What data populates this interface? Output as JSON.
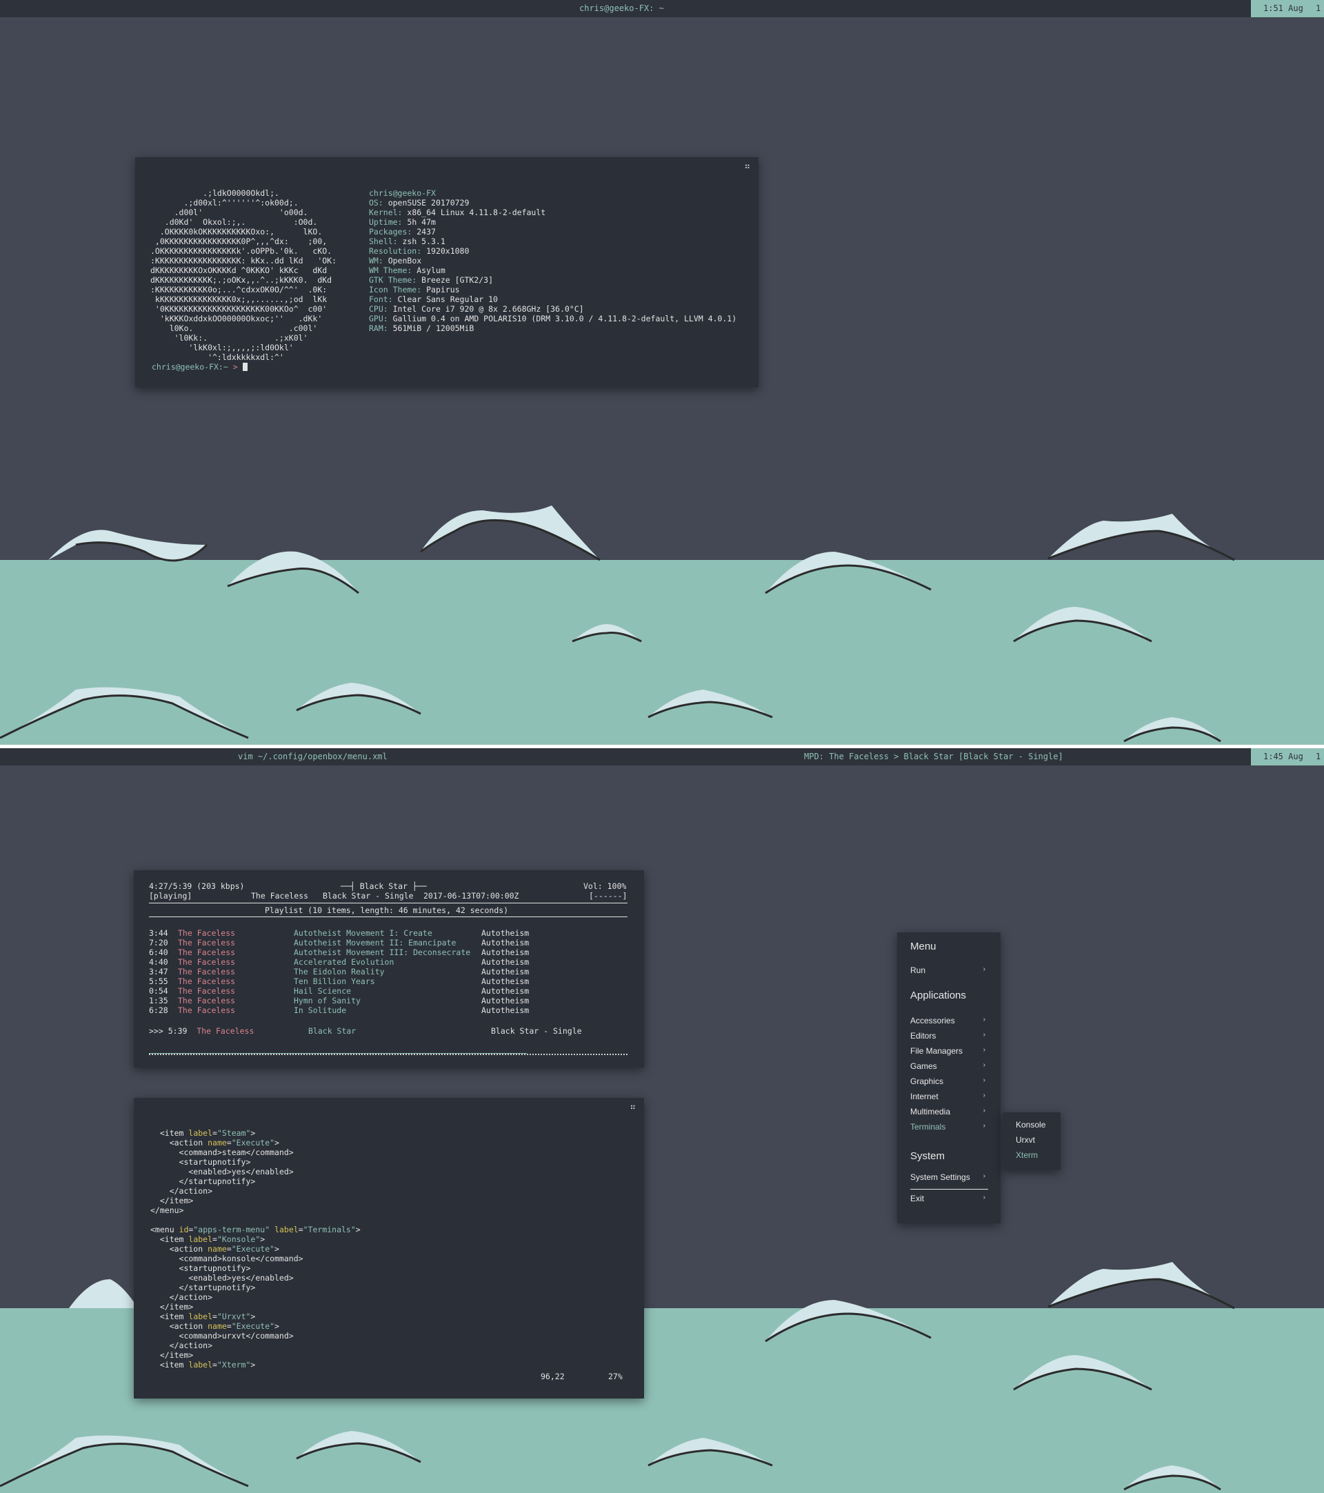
{
  "colors": {
    "bg": "#434854",
    "bar": "#2e323b",
    "accent": "#8fc0b6",
    "terminal": "#2b2f38",
    "sea": "#8fc0b6",
    "wave": "#d3e6ea",
    "red": "#d9848c"
  },
  "screen1": {
    "bar_title": "chris@geeko-FX: ~",
    "clock": "1:51 Aug",
    "workspace": "1",
    "terminal": {
      "ascii": [
        "           .;ldkO0000Okdl;.",
        "       .;d00xl:^''''''^:ok00d;.",
        "     .d00l'                'o00d.",
        "   .d0Kd'  Okxol:;,.          :O0d.",
        "  .OKKKK0kOKKKKKKKKKKOxo:,      lKO.",
        " ,0KKKKKKKKKKKKKKKK0P^,,,^dx:    ;00,",
        ".OKKKKKKKKKKKKKKKKk'.oOPPb.'0k.   cKO.",
        ":KKKKKKKKKKKKKKKKKK: kKx..dd lKd   'OK:",
        "dKKKKKKKKKOxOKKKKd ^0KKKO' kKKc   dKd",
        "dKKKKKKKKKKKK;.;oOKx,,.^..;kKKK0.  dKd",
        ":KKKKKKKKKKK0o;...^cdxxOK0O/^^'  .0K:",
        " kKKKKKKKKKKKKKKK0x;,,......,;od  lKk",
        " '0KKKKKKKKKKKKKKKKKKKKK00KKOo^  c00'",
        "  'kKKKOxddxkOO00000Okxoc;''   .dKk'",
        "    l0Ko.                    .c00l'",
        "     'l0Kk:.              .;xK0l'",
        "        'lkK0xl:;,,,,;:ld0Okl'",
        "            '^:ldxkkkkxdl:^'"
      ],
      "info": [
        {
          "k": "chris@geeko-FX",
          "v": ""
        },
        {
          "k": "OS:",
          "v": " openSUSE 20170729"
        },
        {
          "k": "Kernel:",
          "v": " x86_64 Linux 4.11.8-2-default"
        },
        {
          "k": "Uptime:",
          "v": " 5h 47m"
        },
        {
          "k": "Packages:",
          "v": " 2437"
        },
        {
          "k": "Shell:",
          "v": " zsh 5.3.1"
        },
        {
          "k": "Resolution:",
          "v": " 1920x1080"
        },
        {
          "k": "WM:",
          "v": " OpenBox"
        },
        {
          "k": "WM Theme:",
          "v": " Asylum"
        },
        {
          "k": "GTK Theme:",
          "v": " Breeze [GTK2/3]"
        },
        {
          "k": "Icon Theme:",
          "v": " Papirus"
        },
        {
          "k": "Font:",
          "v": " Clear Sans Regular 10"
        },
        {
          "k": "CPU:",
          "v": " Intel Core i7 920 @ 8x 2.668GHz [36.0°C]"
        },
        {
          "k": "GPU:",
          "v": " Gallium 0.4 on AMD POLARIS10 (DRM 3.10.0 / 4.11.8-2-default, LLVM 4.0.1)"
        },
        {
          "k": "RAM:",
          "v": " 561MiB / 12005MiB"
        }
      ],
      "prompt_user": "chris@geeko-FX:~",
      "prompt_symbol": " > "
    }
  },
  "screen2": {
    "bar_left": "vim ~/.config/openbox/menu.xml",
    "bar_mid": "MPD: The Faceless > Black Star [Black Star - Single]",
    "clock": "1:45 Aug",
    "workspace": "1",
    "ncmpcpp": {
      "time": "4:27/5:39 (203 kbps)",
      "song_title": "Black Star",
      "volume": "Vol: 100%",
      "state": "[playing]",
      "now_artist": "The Faceless",
      "now_album": "Black Star - Single",
      "now_date": "2017-06-13T07:00:00Z",
      "mode_flags": "[------]",
      "playlist_header": "Playlist (10 items, length: 46 minutes, 42 seconds)",
      "playlist": [
        {
          "time": "3:44",
          "artist": "The Faceless",
          "title": "Autotheist Movement I: Create",
          "album": "Autotheism"
        },
        {
          "time": "7:20",
          "artist": "The Faceless",
          "title": "Autotheist Movement II: Emancipate",
          "album": "Autotheism"
        },
        {
          "time": "6:40",
          "artist": "The Faceless",
          "title": "Autotheist Movement III: Deconsecrate",
          "album": "Autotheism"
        },
        {
          "time": "4:40",
          "artist": "The Faceless",
          "title": "Accelerated Evolution",
          "album": "Autotheism"
        },
        {
          "time": "3:47",
          "artist": "The Faceless",
          "title": "The Eidolon Reality",
          "album": "Autotheism"
        },
        {
          "time": "5:55",
          "artist": "The Faceless",
          "title": "Ten Billion Years",
          "album": "Autotheism"
        },
        {
          "time": "0:54",
          "artist": "The Faceless",
          "title": "Hail Science",
          "album": "Autotheism"
        },
        {
          "time": "1:35",
          "artist": "The Faceless",
          "title": "Hymn of Sanity",
          "album": "Autotheism"
        },
        {
          "time": "6:28",
          "artist": "The Faceless",
          "title": "In Solitude",
          "album": "Autotheism"
        }
      ],
      "current": {
        "marker": ">>>",
        "time": "5:39",
        "artist": "The Faceless",
        "title": "Black Star",
        "album": "Black Star - Single"
      },
      "progress": 0.79
    },
    "vim": {
      "lines": [
        "  <item label=\"Steam\">",
        "    <action name=\"Execute\">",
        "      <command>steam</command>",
        "      <startupnotify>",
        "        <enabled>yes</enabled>",
        "      </startupnotify>",
        "    </action>",
        "  </item>",
        "</menu>",
        "",
        "<menu id=\"apps-term-menu\" label=\"Terminals\">",
        "  <item label=\"Konsole\">",
        "    <action name=\"Execute\">",
        "      <command>konsole</command>",
        "      <startupnotify>",
        "        <enabled>yes</enabled>",
        "      </startupnotify>",
        "    </action>",
        "  </item>",
        "  <item label=\"Urxvt\">",
        "    <action name=\"Execute\">",
        "      <command>urxvt</command>",
        "    </action>",
        "  </item>",
        "  <item label=\"Xterm\">"
      ],
      "position": "96,22",
      "percent": "27%"
    },
    "menu": {
      "title": "Menu",
      "run": "Run",
      "apps_header": "Applications",
      "apps": [
        "Accessories",
        "Editors",
        "File Managers",
        "Games",
        "Graphics",
        "Internet",
        "Multimedia",
        "Terminals"
      ],
      "system_header": "System",
      "system_settings": "System Settings",
      "exit": "Exit",
      "submenu": [
        "Konsole",
        "Urxvt",
        "Xterm"
      ],
      "arrow": "›"
    }
  }
}
